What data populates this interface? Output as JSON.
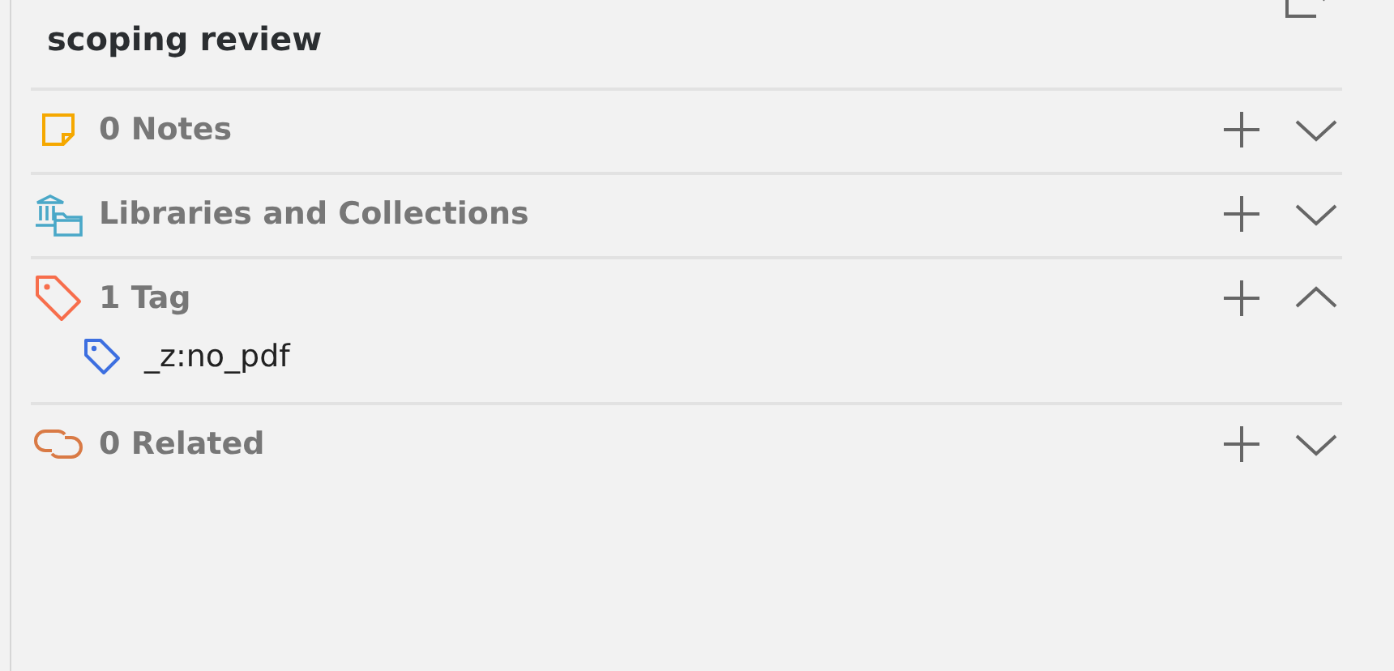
{
  "title": "scoping review",
  "sections": [
    {
      "kind": "notes",
      "label": "0 Notes",
      "expanded": false
    },
    {
      "kind": "libraries",
      "label": "Libraries and Collections",
      "expanded": false
    },
    {
      "kind": "tags",
      "label": "1 Tag",
      "expanded": true,
      "children": [
        {
          "label": "_z:no_pdf"
        }
      ]
    },
    {
      "kind": "related",
      "label": "0 Related",
      "expanded": false
    }
  ]
}
